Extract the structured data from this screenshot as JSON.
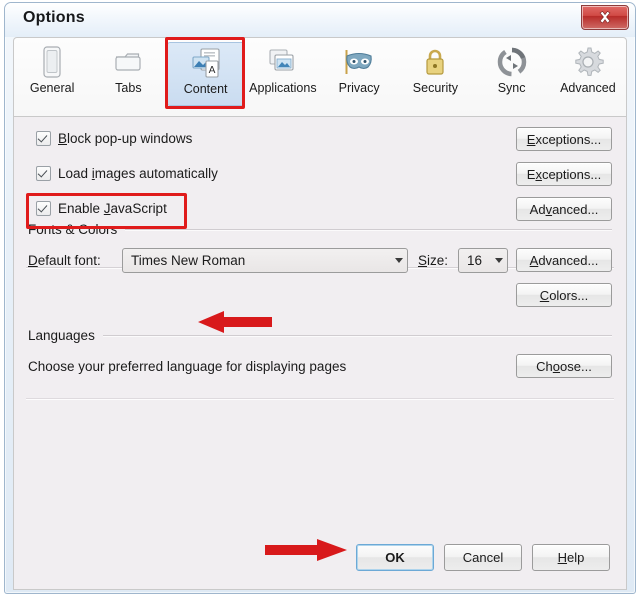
{
  "window": {
    "title": "Options",
    "close_icon": "close-icon"
  },
  "tabs": [
    {
      "label": "General",
      "icon": "general-icon",
      "selected": false
    },
    {
      "label": "Tabs",
      "icon": "tabs-icon",
      "selected": false
    },
    {
      "label": "Content",
      "icon": "content-icon",
      "selected": true
    },
    {
      "label": "Applications",
      "icon": "applications-icon",
      "selected": false
    },
    {
      "label": "Privacy",
      "icon": "privacy-mask-icon",
      "selected": false
    },
    {
      "label": "Security",
      "icon": "padlock-icon",
      "selected": false
    },
    {
      "label": "Sync",
      "icon": "sync-arrows-icon",
      "selected": false
    },
    {
      "label": "Advanced",
      "icon": "gear-icon",
      "selected": false
    }
  ],
  "content": {
    "checkboxes": [
      {
        "label": "Block pop-up windows",
        "accel": "B",
        "checked": true,
        "button": "Exceptions...",
        "button_accel": "E"
      },
      {
        "label": "Load images automatically",
        "accel": "i",
        "checked": true,
        "button": "Exceptions...",
        "button_accel": "x"
      },
      {
        "label": "Enable JavaScript",
        "accel": "J",
        "checked": true,
        "button": "Advanced...",
        "button_accel": "v"
      }
    ],
    "fonts_group": {
      "title": "Fonts & Colors",
      "default_font_label": "Default font:",
      "default_font_accel": "D",
      "default_font_value": "Times New Roman",
      "size_label": "Size:",
      "size_accel": "S",
      "size_value": "16",
      "advanced_button": "Advanced...",
      "advanced_accel": "A",
      "colors_button": "Colors...",
      "colors_accel": "C"
    },
    "languages_group": {
      "title": "Languages",
      "description": "Choose your preferred language for displaying pages",
      "choose_button": "Choose...",
      "choose_accel": "o"
    }
  },
  "footer": {
    "ok_label": "OK",
    "cancel_label": "Cancel",
    "help_label": "Help",
    "help_accel": "H"
  },
  "annotations": {
    "highlight_color": "#e01b1b",
    "arrow_color": "#d8191b",
    "content_tab_box": "content-tab-highlight",
    "javascript_box": "javascript-highlight",
    "arrow_to_javascript": "arrow-left-to-javascript",
    "arrow_to_ok": "arrow-right-to-ok"
  }
}
